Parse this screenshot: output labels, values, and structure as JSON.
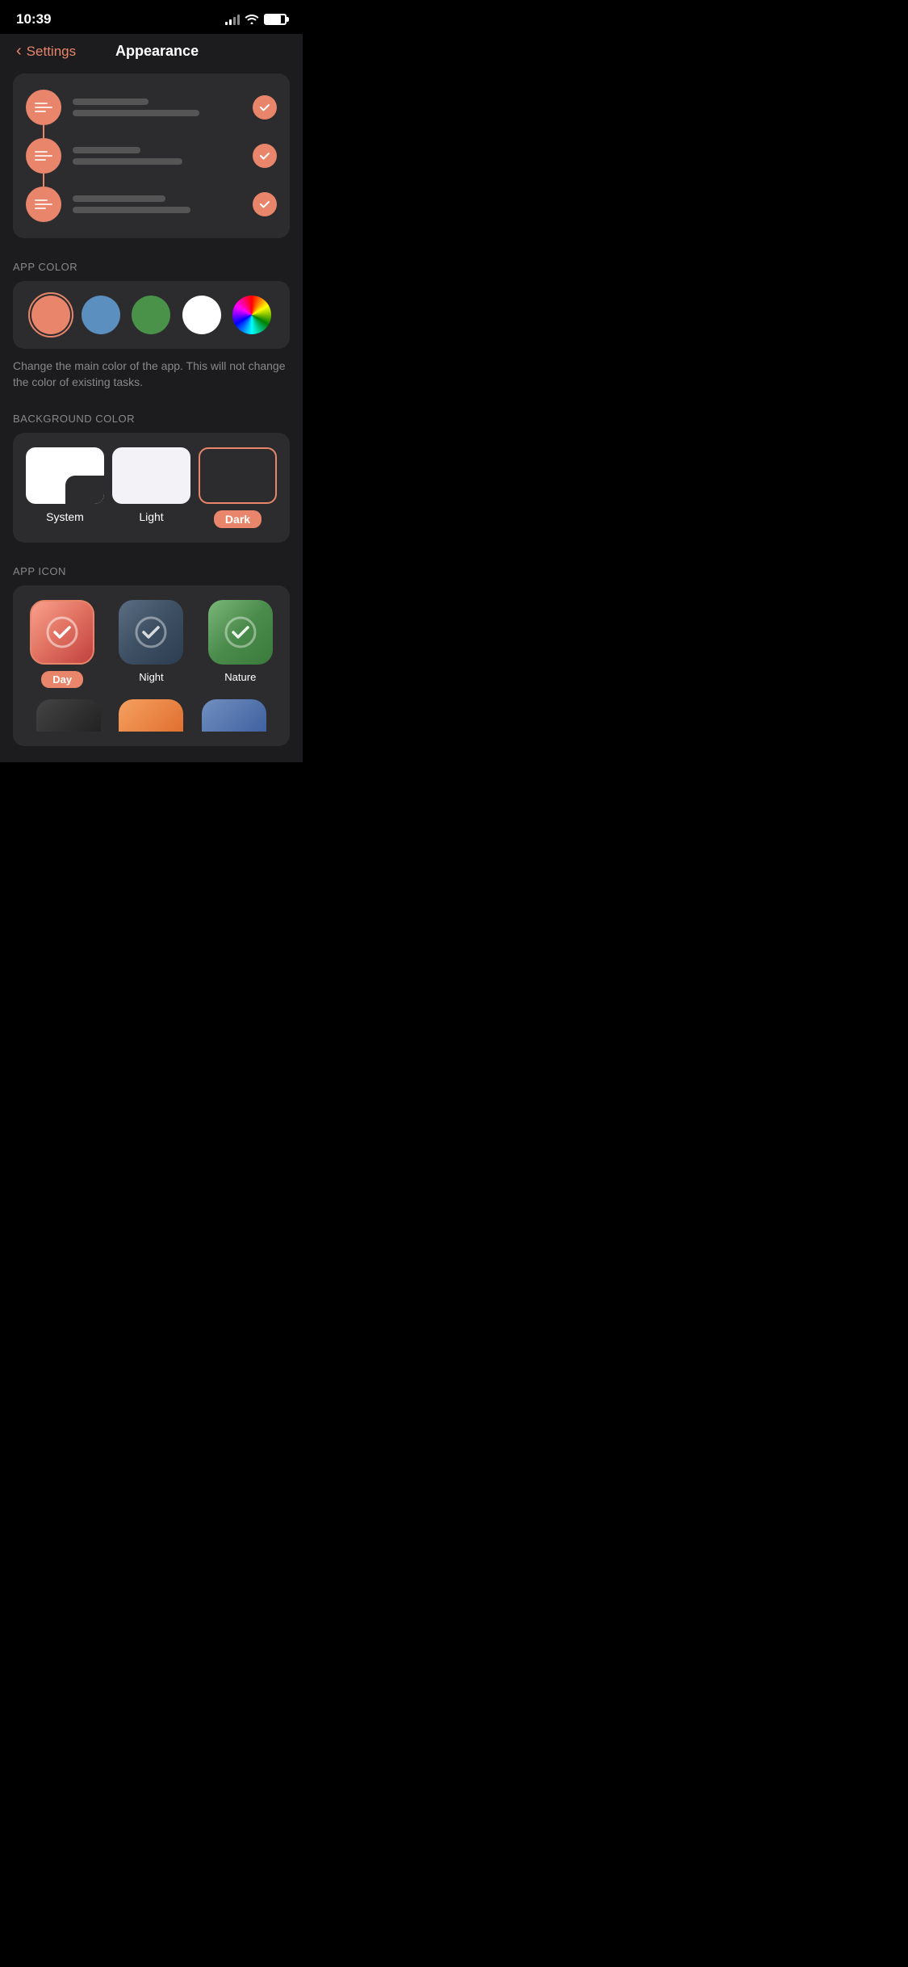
{
  "statusBar": {
    "time": "10:39"
  },
  "navBar": {
    "backLabel": "Settings",
    "title": "Appearance"
  },
  "sections": {
    "appColor": {
      "label": "APP COLOR",
      "colors": [
        {
          "id": "salmon",
          "hex": "#E8856A",
          "selected": true
        },
        {
          "id": "blue",
          "hex": "#5B8FBF",
          "selected": false
        },
        {
          "id": "green",
          "hex": "#4A924A",
          "selected": false
        },
        {
          "id": "white",
          "hex": "#FFFFFF",
          "selected": false
        },
        {
          "id": "rainbow",
          "hex": "rainbow",
          "selected": false
        }
      ],
      "hint": "Change the main color of the app. This will not change the color of existing tasks."
    },
    "backgroundColor": {
      "label": "BACKGROUND COLOR",
      "options": [
        {
          "id": "system",
          "label": "System",
          "active": false
        },
        {
          "id": "light",
          "label": "Light",
          "active": false
        },
        {
          "id": "dark",
          "label": "Dark",
          "active": true
        }
      ]
    },
    "appIcon": {
      "label": "APP ICON",
      "icons": [
        {
          "id": "day",
          "label": "Day",
          "active": true
        },
        {
          "id": "night",
          "label": "Night",
          "active": false
        },
        {
          "id": "nature",
          "label": "Nature",
          "active": false
        }
      ]
    }
  }
}
